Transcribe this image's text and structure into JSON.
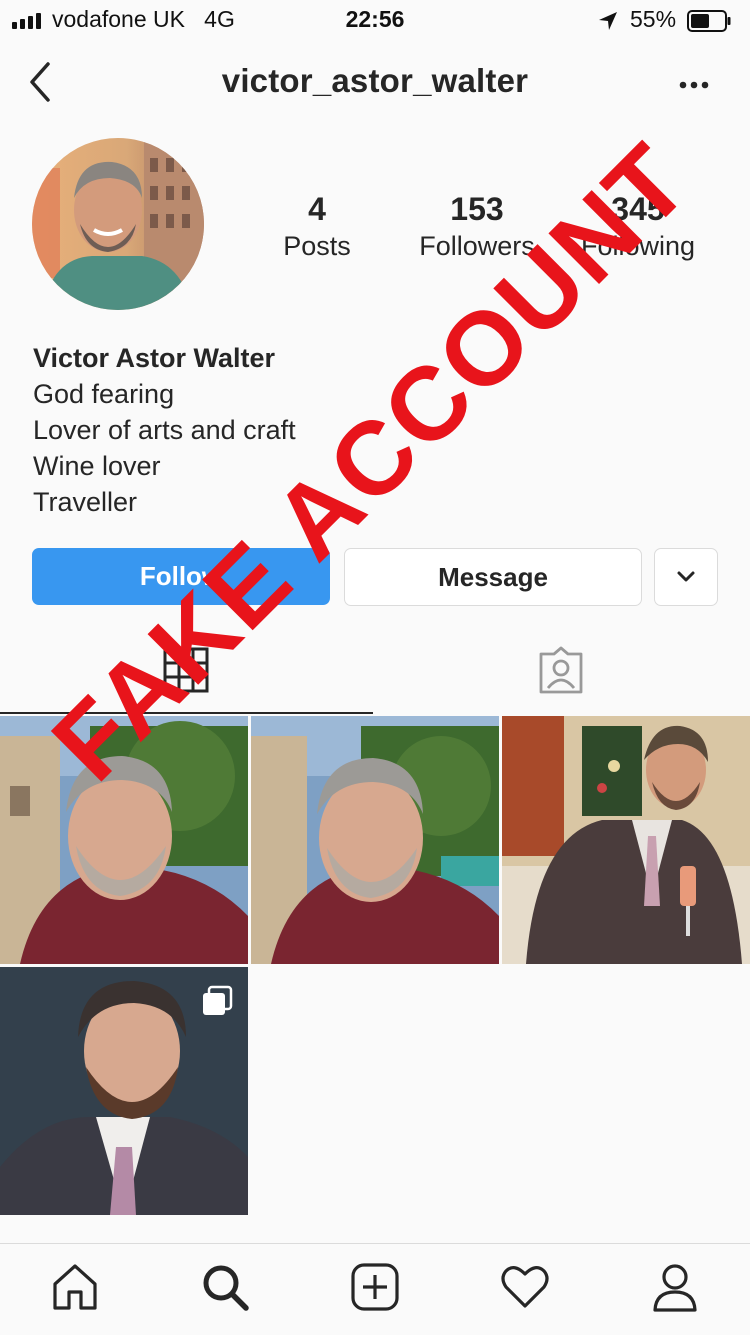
{
  "status_bar": {
    "carrier": "vodafone UK",
    "network": "4G",
    "time": "22:56",
    "battery": "55%",
    "battery_level": 0.55
  },
  "header": {
    "username": "victor_astor_walter",
    "back_icon": "chevron-left-icon",
    "more_icon": "ellipsis-icon"
  },
  "profile": {
    "stats": [
      {
        "value": "4",
        "label": "Posts"
      },
      {
        "value": "153",
        "label": "Followers"
      },
      {
        "value": "345",
        "label": "Following"
      }
    ],
    "name": "Victor Astor Walter",
    "bio_lines": [
      "God fearing",
      "Lover of arts and craft",
      "Wine lover",
      "Traveller"
    ]
  },
  "actions": {
    "follow_label": "Follow",
    "message_label": "Message",
    "follow_color": "#3897f0"
  },
  "tabs": [
    {
      "icon": "grid-icon",
      "active": true
    },
    {
      "icon": "tagged-photos-icon",
      "active": false
    }
  ],
  "posts": [
    {
      "subject": "selfie-outdoor-1"
    },
    {
      "subject": "selfie-outdoor-2"
    },
    {
      "subject": "suit-champagne"
    },
    {
      "subject": "portrait-suit",
      "multi": true
    }
  ],
  "overlay": {
    "text": "FAKE ACCOUNT",
    "color": "#e8141b"
  },
  "bottom_nav": [
    "home-icon",
    "search-icon",
    "new-post-icon",
    "activity-heart-icon",
    "profile-icon"
  ]
}
